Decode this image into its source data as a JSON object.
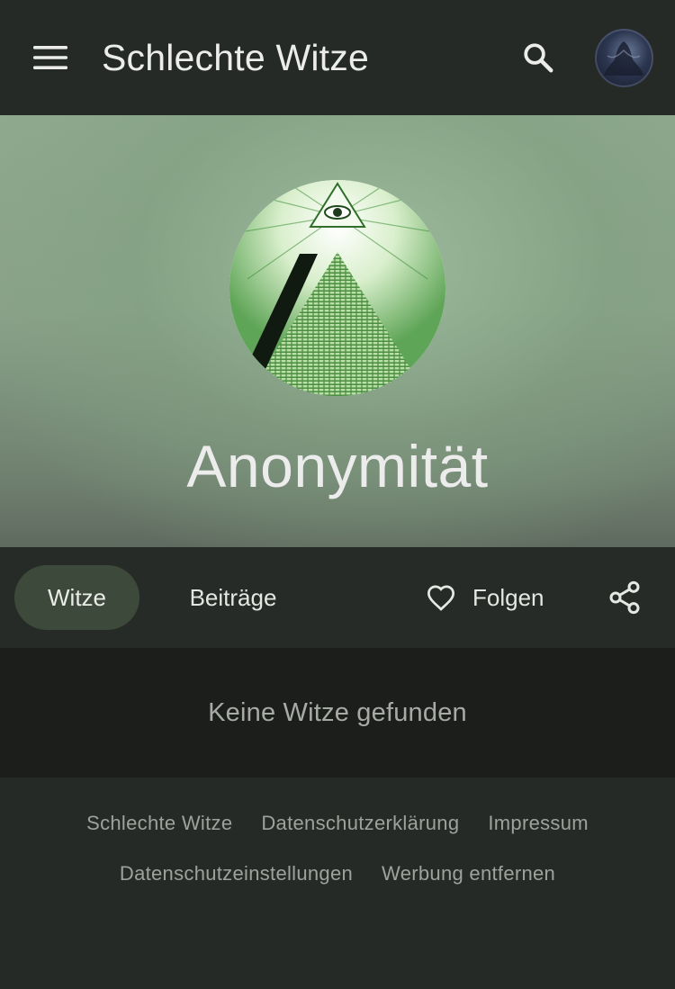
{
  "appbar": {
    "title": "Schlechte Witze",
    "menu_icon": "menu-icon",
    "search_icon": "search-icon",
    "avatar_icon": "user-avatar"
  },
  "hero": {
    "title": "Anonymität",
    "emblem_icon": "pyramid-eye-emblem"
  },
  "tabs": {
    "witze": "Witze",
    "beitraege": "Beiträge",
    "follow": "Folgen",
    "heart_icon": "heart-outline-icon",
    "share_icon": "share-icon",
    "active_tab": "Witze"
  },
  "content": {
    "empty_message": "Keine Witze gefunden"
  },
  "footer": {
    "links_row1": [
      "Schlechte Witze",
      "Datenschutzerklärung",
      "Impressum"
    ],
    "links_row2": [
      "Datenschutzeinstellungen",
      "Werbung entfernen"
    ]
  },
  "colors": {
    "appbar_bg": "#262a26",
    "active_tab_bg": "#3d4a3b",
    "empty_bg": "#1c1e1b",
    "footer_link": "#9ea29d"
  }
}
